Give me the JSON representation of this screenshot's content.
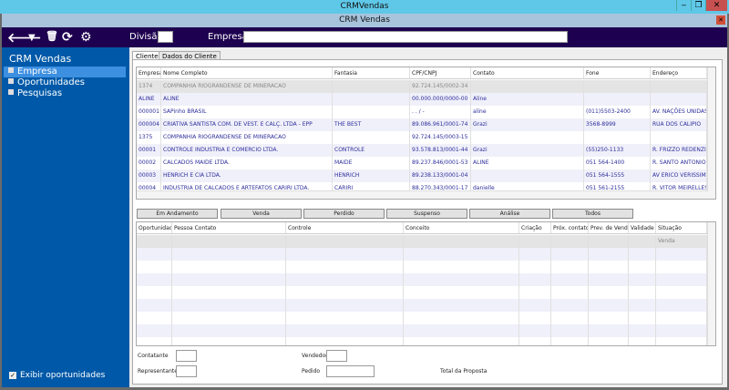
{
  "window": {
    "title": "CRMVendas",
    "inner_title": "CRM Vendas",
    "minimize": "‒",
    "restore": "❐",
    "close": "✕"
  },
  "toolbar": {
    "icons": [
      "back-arrow-icon",
      "filter-icon",
      "trash-icon",
      "refresh-icon",
      "gear-icon"
    ],
    "glyphs": [
      "🡐",
      "▼",
      "🗑",
      "⟳",
      "⚙"
    ],
    "divisao_label": "Divisão",
    "divisao_value": "",
    "empresa_label": "Empresa",
    "empresa_value": ""
  },
  "sidebar": {
    "title": "CRM Vendas",
    "items": [
      {
        "label": "Empresa",
        "selected": true
      },
      {
        "label": "Oportunidades"
      },
      {
        "label": "Pesquisas"
      }
    ],
    "checkbox_label": "Exibir oportunidades",
    "checkbox_checked": true
  },
  "tabs": [
    {
      "label": "Clientes",
      "active": true
    },
    {
      "label": "Dados do Cliente"
    }
  ],
  "clients": {
    "columns": [
      "Empresa",
      "Nome Completo",
      "Fantasia",
      "CPF/CNPJ",
      "Contato",
      "Fone",
      "Endereço"
    ],
    "rows": [
      [
        "1374",
        "COMPANHIA RIOGRANDENSE DE MINERACAO",
        "",
        "92.724.145/0002-34",
        "",
        "",
        ""
      ],
      [
        "ALINE",
        "ALINE",
        "",
        "00.000.000/0000-00",
        "Aline",
        "",
        ""
      ],
      [
        "000001",
        "SAPinho BRASIL",
        "",
        "  .  .  /  -",
        "aline",
        "(011)5503-2400",
        "AV. NAÇÕES UNIDAS"
      ],
      [
        "000004",
        "CRIATIVA SANTISTA COM. DE VEST. E CALÇ. LTDA - EPP",
        "THE BEST",
        "89.086.961/0001-74",
        "Grazi",
        "3568-8999",
        "RUA DOS CALIPIO"
      ],
      [
        "1375",
        "COMPANHIA RIOGRANDENSE DE MINERACAO",
        "",
        "92.724.145/0003-15",
        "",
        "",
        ""
      ],
      [
        "00001",
        "CONTROLE INDUSTRIA E COMERCIO LTDA.",
        "CONTROLE",
        "93.578.813/0001-44",
        "Grazi",
        "(55)250-1133",
        "R. FRIZZO REDENZIO"
      ],
      [
        "00002",
        "CALCADOS MAIDE LTDA.",
        "MAIDE",
        "89.237.846/0001-53",
        "ALINE",
        "051 564-1400",
        "R. SANTO ANTONIO D"
      ],
      [
        "00003",
        "HENRICH E CIA LTDA.",
        "HENRICH",
        "89.238.133/0001-04",
        "",
        "051 564-1555",
        "AV ERICO VERISSIMO"
      ],
      [
        "00004",
        "INDUSTRIA DE CALCADOS E ARTEFATOS CARIRI LTDA.",
        "CARIRI",
        "88.270.343/0001-17",
        "danielle",
        "051 561-2155",
        "R. VITOR MEIRELLES,"
      ]
    ]
  },
  "filters": [
    "Em Andamento",
    "Venda",
    "Perdido",
    "Suspenso",
    "Análise",
    "Todos"
  ],
  "opportunities": {
    "columns": [
      "Oportunidade",
      "Pessoa Contato",
      "Controle",
      "Conceito",
      "Criação",
      "Próx. contato",
      "Prev. de Venda",
      "Validade",
      "Situação"
    ],
    "rows": [
      [
        "",
        "",
        "",
        "",
        "",
        "",
        "",
        "",
        "Venda"
      ]
    ]
  },
  "form": {
    "contatante_label": "Contatante",
    "representante_label": "Representante",
    "vendedor_label": "Vendedor",
    "pedido_label": "Pedido",
    "total_label": "Total da Proposta"
  }
}
